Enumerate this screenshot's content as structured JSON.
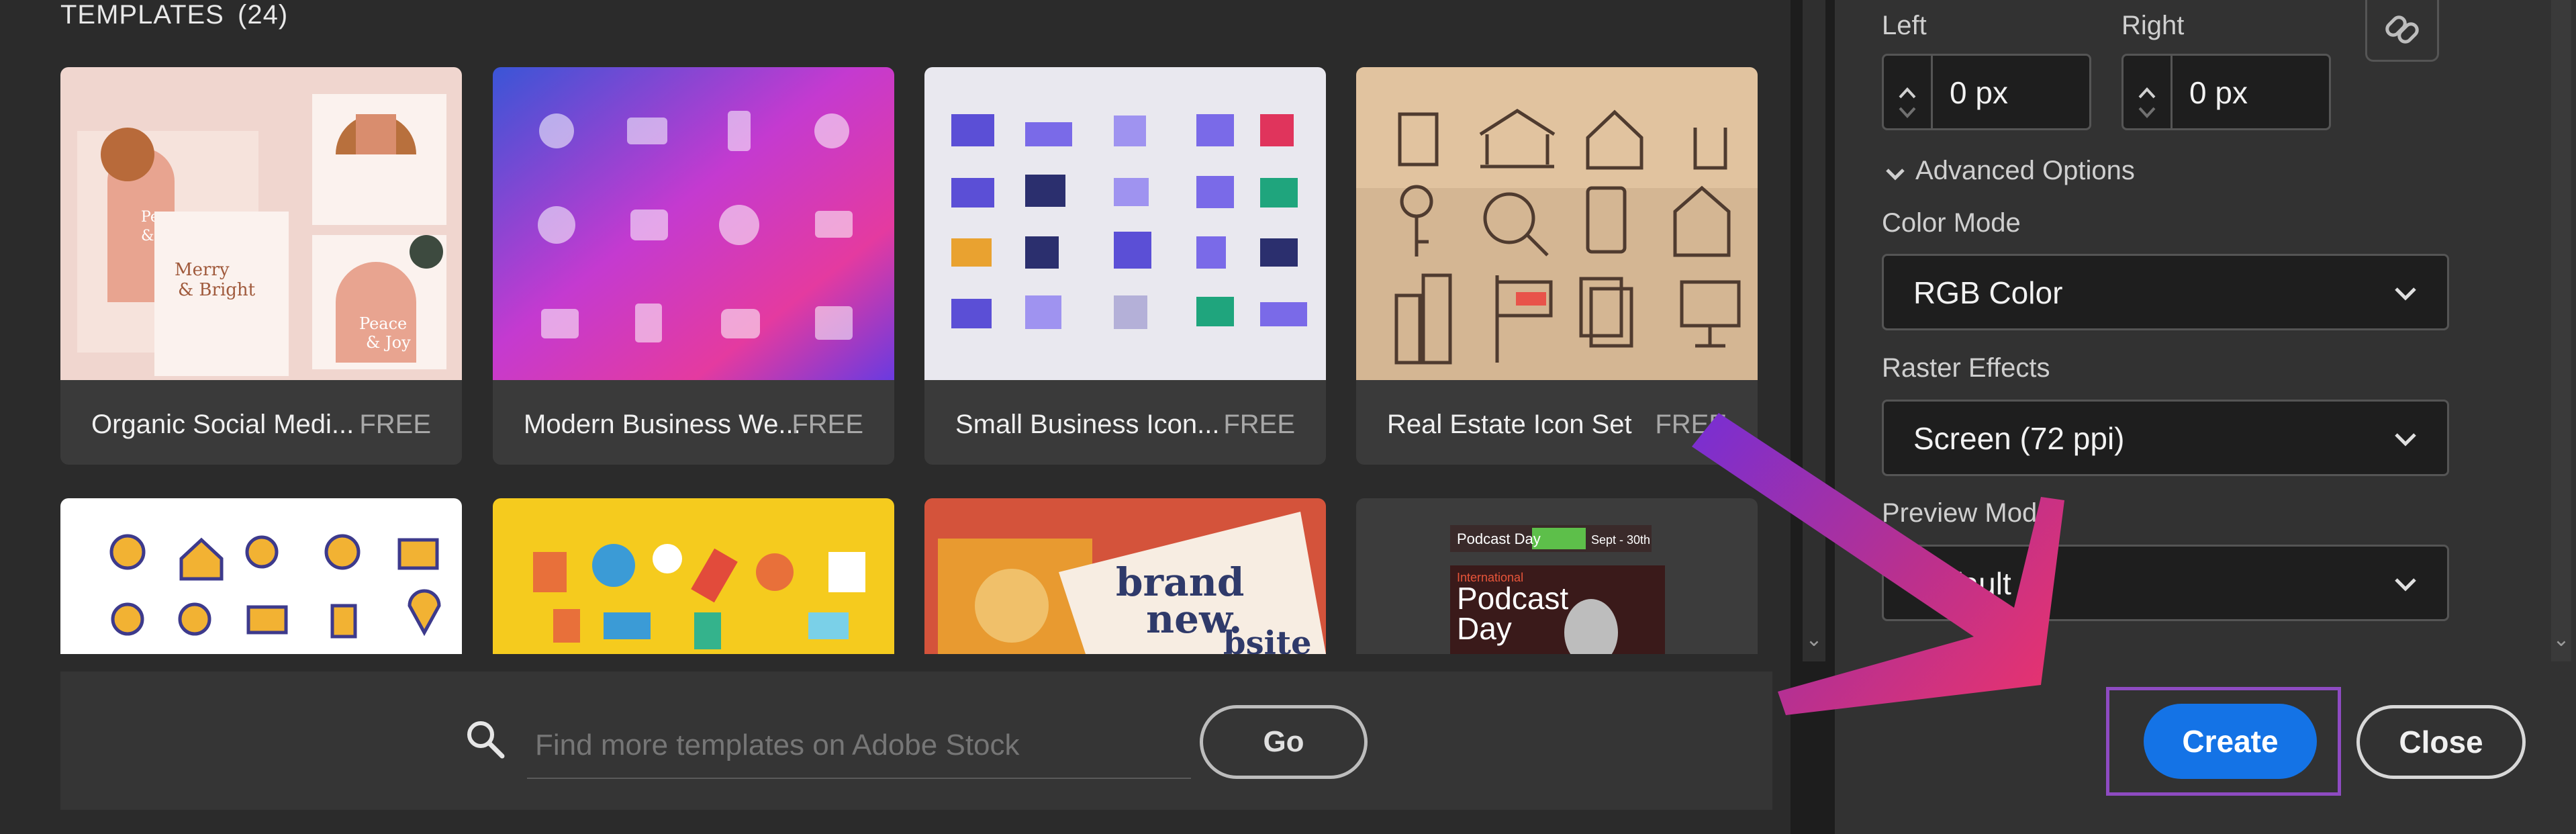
{
  "templates": {
    "heading": "TEMPLATES",
    "count": "(24)",
    "cards": [
      {
        "title": "Organic Social Medi...",
        "badge": "FREE"
      },
      {
        "title": "Modern Business We...",
        "badge": "FREE"
      },
      {
        "title": "Small Business Icon...",
        "badge": "FREE"
      },
      {
        "title": "Real Estate Icon Set",
        "badge": "FREE"
      }
    ],
    "row2_text": {
      "brand": "brand",
      "new": "new.",
      "site": "bsite",
      "podcast_banner": "Podcast Day",
      "podcast_date": "Sept - 30th",
      "podcast_big": "Podcast",
      "podcast_big2": "Day",
      "podcast_international": "International"
    }
  },
  "search": {
    "placeholder": "Find more templates on Adobe Stock",
    "go_label": "Go"
  },
  "settings": {
    "left_label": "Left",
    "left_value": "0 px",
    "right_label": "Right",
    "right_value": "0 px",
    "advanced_label": "Advanced Options",
    "color_mode_label": "Color Mode",
    "color_mode_value": "RGB Color",
    "raster_label": "Raster Effects",
    "raster_value": "Screen (72 ppi)",
    "preview_label": "Preview Mode",
    "preview_value": "Default"
  },
  "actions": {
    "create_label": "Create",
    "close_label": "Close"
  },
  "colors": {
    "accent_blue": "#1473e6",
    "arrow_purple": "#7b2fd0",
    "arrow_pink": "#e8336e",
    "highlight_border": "#8e4bc2"
  },
  "icons": [
    "search-icon",
    "link-icon",
    "chevron-down-icon",
    "stepper-up-icon",
    "stepper-down-icon"
  ]
}
